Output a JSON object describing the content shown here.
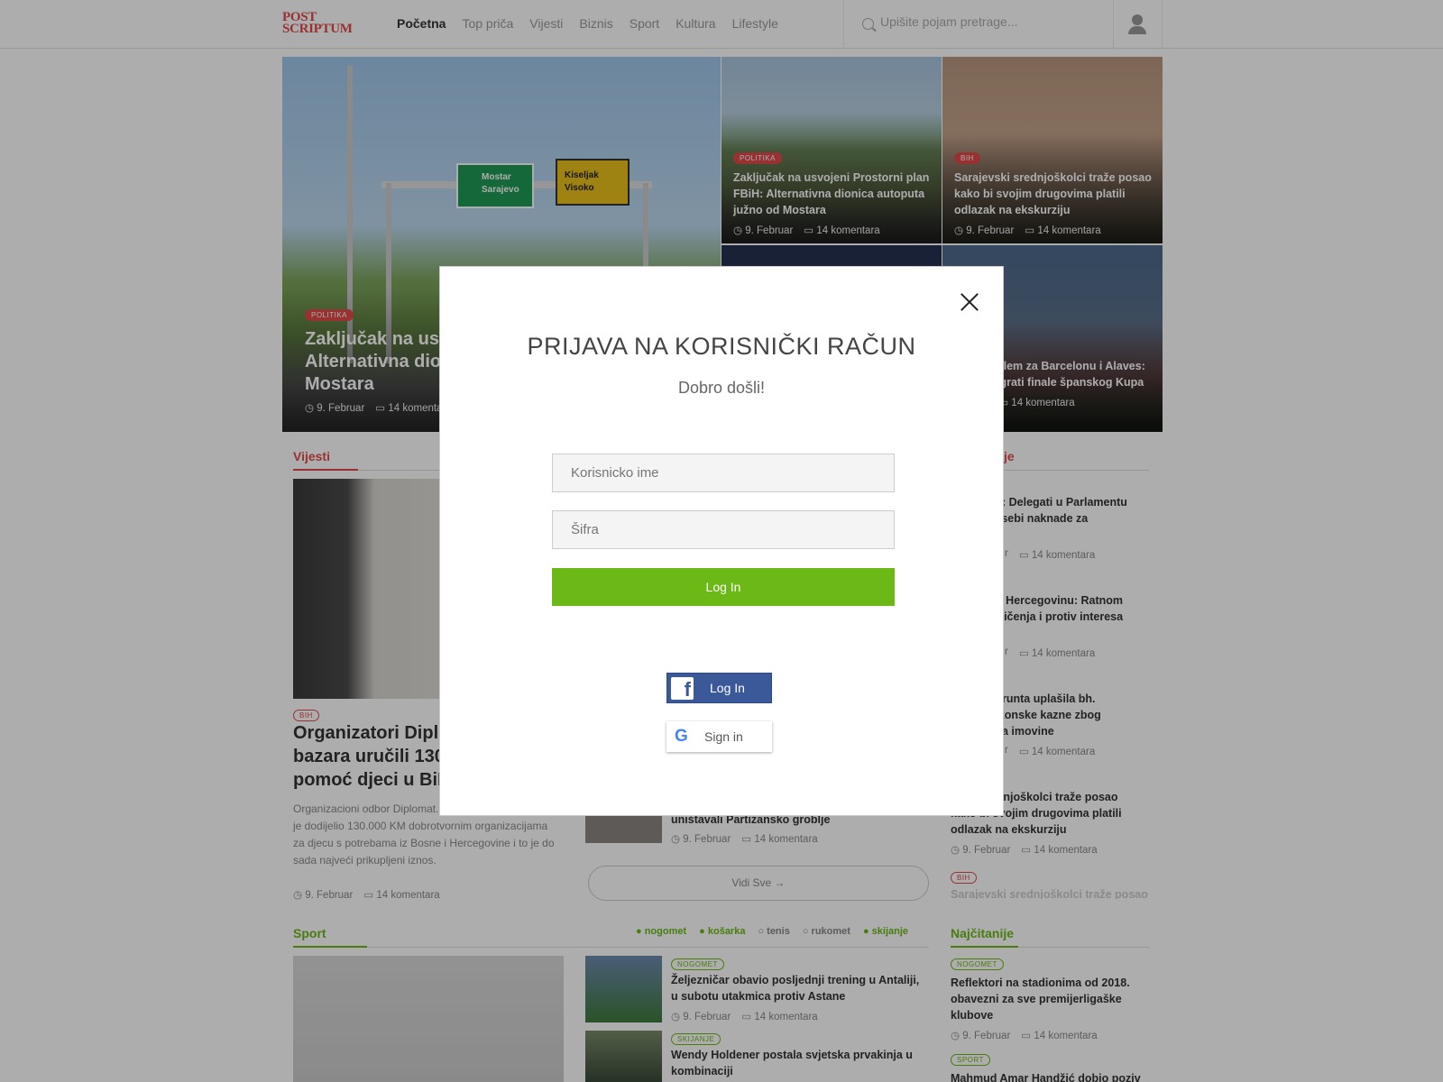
{
  "header": {
    "logo": [
      "POST",
      "SCRIPTUM"
    ],
    "nav": [
      "Početna",
      "Top priča",
      "Vijesti",
      "Biznis",
      "Sport",
      "Kultura",
      "Lifestyle"
    ],
    "search_placeholder": "Upišite pojam pretrage..."
  },
  "hero": {
    "badge": "POLITIKA",
    "title": "Zaključak na usvojeni Prostorni plan FBiH: Alternativna dionica autoputa južno od Mostara",
    "title_visible": [
      "Zaključak na us",
      "Alternativna dio",
      "Mostara"
    ],
    "date": "9. Februar",
    "comments": "14 komentara",
    "comments_visible": "14 komentara",
    "signs": {
      "green": [
        "Mostar",
        "Sarajevo"
      ],
      "yellow": [
        "Kiseljak",
        "Visoko"
      ]
    }
  },
  "cards": [
    {
      "badge": "POLITIKA",
      "title": "Zaključak na usvojeni Prostorni plan FBiH: Alternativna dionica autoputa južno od Mostara",
      "date": "9. Februar",
      "comments": "14 komentara"
    },
    {
      "badge": "BIH",
      "title": "Sarajevski srednjoškolci traže posao kako bi svojim drugovima platili odlazak na ekskurziju",
      "date": "9. Februar",
      "comments": "14 komentara"
    },
    {
      "title": "blem za Barcelonu i Alaves: igrati finale španskog Kupa",
      "date": "ar",
      "comments": "14 komentara"
    }
  ],
  "vijesti": {
    "heading": "Vijesti",
    "badge": "BIH",
    "title": [
      "Organizatori Dipl",
      "bazara uručili 130",
      "pomoć djeci u BiH"
    ],
    "excerpt": [
      "Organizacioni odbor Diplomat...",
      "je dodijelio 130.000 KM dobrotvornim organizacijama",
      "za djecu s potrebama iz Bosne i Hercegovine i to je do",
      "sada najveći prikupljeni iznos."
    ],
    "date": "9. Februar",
    "comments": "14 komentara",
    "mid_item": "uništavali Partizansko groblje",
    "mid_date": "9. Februar",
    "mid_comments": "14 komentara",
    "vidi_sve": "Vidi Sve →"
  },
  "right_col": {
    "heading": "je",
    "items": [
      {
        "title": [
          "otez: Delegati u Parlamentu",
          "čali sebi naknade za",
          "ivot"
        ],
        "date": "r",
        "comments": "14 komentara"
      },
      {
        "title": [
          "kroz Hercegovinu: Ratnom",
          "graničenja i protiv interesa",
          "tva"
        ],
        "date": "r",
        "comments": "14 komentara"
      },
      {
        "title": [
          "ija grunta uplašila bh.",
          "Drakonske kazne zbog",
          "vanja imovine"
        ],
        "date": "r",
        "comments": "14 komentara"
      },
      {
        "title": [
          "srednjoškolci traže posao",
          "kako bi svojim drugovima platili",
          "odlazak na ekskurziju"
        ],
        "date": "9. Februar",
        "comments": "14 komentara"
      }
    ],
    "tail_badge": "BIH",
    "tail_title": "Sarajevski srednjoškolci traže posao"
  },
  "sport": {
    "heading": "Sport",
    "tabs": [
      "nogomet",
      "košarka",
      "tenis",
      "rukomet",
      "skijanje"
    ],
    "items": [
      {
        "badge": "NOGOMET",
        "title": [
          "Željezničar obavio posljednji trening u Antaliji,",
          "u subotu utakmica protiv Astane"
        ],
        "date": "9. Februar",
        "comments": "14 komentara"
      },
      {
        "badge": "SKIJANJE",
        "title": [
          "Wendy Holdener postala svjetska prvakinja u",
          "kombinaciji"
        ]
      }
    ]
  },
  "najcitanije": {
    "heading": "Najčitanije",
    "items": [
      {
        "badge": "NOGOMET",
        "title": [
          "Reflektori na stadionima od 2018.",
          "obavezni za sve premijerligaške",
          "klubove"
        ],
        "date": "9. Februar",
        "comments": "14 komentara"
      },
      {
        "badge": "SPORT",
        "title": [
          "Mahmud Amar Handžić dobio poziv"
        ]
      }
    ]
  },
  "modal": {
    "title": "PRIJAVA NA KORISNIČKI RAČUN",
    "subtitle": "Dobro došli!",
    "username_placeholder": "Korisnicko ime",
    "password_placeholder": "Šifra",
    "login": "Log In",
    "fb_login": "Log In",
    "google_signin": "Sign in"
  },
  "colors": {
    "accent_red": "#e04a4a",
    "accent_green": "#6bb816",
    "facebook": "#3b5998"
  }
}
